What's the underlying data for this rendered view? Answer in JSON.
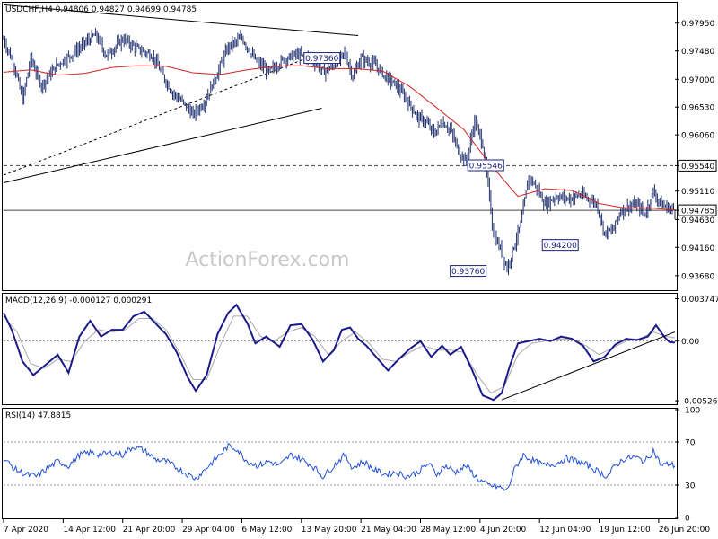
{
  "header": {
    "price_title": "USDCHF,H4  0.94806 0.94827 0.94699 0.94785",
    "macd_title": "MACD(12,26,9) -0.000127 0.000291",
    "rsi_title": "RSI(14) 47.8815"
  },
  "watermark": "ActionForex.com",
  "colors": {
    "price_bar": "#1f2f6e",
    "moving_average": "#d32020",
    "macd_line": "#1a1a8a",
    "macd_signal": "#a8a8a8",
    "rsi_line": "#1f4fd8",
    "trendline": "#000000",
    "hline": "#444444",
    "label_border": "#1a237e",
    "label_text": "#1a237e"
  },
  "chart_data": [
    {
      "type": "candlestick",
      "title": "USDCHF,H4  0.94806 0.94827 0.94699 0.94785",
      "ylim": [
        0.9345,
        0.9828
      ],
      "y_ticks": [
        "0.97950",
        "0.97480",
        "0.97000",
        "0.96530",
        "0.96060",
        "0.95540",
        "0.95110",
        "0.94785",
        "0.94630",
        "0.94160",
        "0.93680"
      ],
      "y_tick_values": [
        0.9795,
        0.9748,
        0.97,
        0.9653,
        0.9606,
        0.9554,
        0.9511,
        0.94785,
        0.9463,
        0.9416,
        0.9368
      ],
      "highlighted_ticks": [
        "0.95540",
        "0.94785"
      ],
      "x_labels": [
        "7 Apr 2020",
        "14 Apr 12:00",
        "21 Apr 20:00",
        "29 Apr 04:00",
        "6 May 12:00",
        "13 May 20:00",
        "21 May 04:00",
        "28 May 12:00",
        "4 Jun 20:00",
        "12 Jun 04:00",
        "19 Jun 12:00",
        "26 Jun 20:00"
      ],
      "x_label_index": [
        0,
        44,
        88,
        132,
        176,
        220,
        264,
        308,
        352,
        396,
        440,
        484
      ],
      "bar_count": 497,
      "close_anchors": [
        [
          0,
          0.9768
        ],
        [
          8,
          0.9722
        ],
        [
          14,
          0.9665
        ],
        [
          20,
          0.9735
        ],
        [
          28,
          0.969
        ],
        [
          40,
          0.9725
        ],
        [
          52,
          0.9745
        ],
        [
          62,
          0.9765
        ],
        [
          68,
          0.9775
        ],
        [
          76,
          0.974
        ],
        [
          88,
          0.9768
        ],
        [
          100,
          0.975
        ],
        [
          110,
          0.974
        ],
        [
          118,
          0.9705
        ],
        [
          124,
          0.968
        ],
        [
          132,
          0.9662
        ],
        [
          140,
          0.964
        ],
        [
          148,
          0.966
        ],
        [
          156,
          0.97
        ],
        [
          166,
          0.9755
        ],
        [
          176,
          0.977
        ],
        [
          186,
          0.9732
        ],
        [
          196,
          0.9712
        ],
        [
          206,
          0.9732
        ],
        [
          216,
          0.9742
        ],
        [
          228,
          0.9735
        ],
        [
          236,
          0.9712
        ],
        [
          244,
          0.9723
        ],
        [
          252,
          0.9745
        ],
        [
          258,
          0.9705
        ],
        [
          264,
          0.9735
        ],
        [
          274,
          0.9725
        ],
        [
          282,
          0.9705
        ],
        [
          290,
          0.969
        ],
        [
          298,
          0.9665
        ],
        [
          306,
          0.9635
        ],
        [
          312,
          0.9628
        ],
        [
          318,
          0.9608
        ],
        [
          324,
          0.9628
        ],
        [
          330,
          0.9615
        ],
        [
          336,
          0.958
        ],
        [
          342,
          0.956
        ],
        [
          348,
          0.963
        ],
        [
          354,
          0.959
        ],
        [
          358,
          0.952
        ],
        [
          362,
          0.9438
        ],
        [
          368,
          0.9408
        ],
        [
          372,
          0.938
        ],
        [
          376,
          0.941
        ],
        [
          382,
          0.9455
        ],
        [
          388,
          0.9535
        ],
        [
          394,
          0.9516
        ],
        [
          400,
          0.9488
        ],
        [
          408,
          0.9502
        ],
        [
          418,
          0.9498
        ],
        [
          426,
          0.9505
        ],
        [
          432,
          0.9498
        ],
        [
          438,
          0.949
        ],
        [
          444,
          0.944
        ],
        [
          450,
          0.9444
        ],
        [
          456,
          0.9478
        ],
        [
          462,
          0.9485
        ],
        [
          468,
          0.9488
        ],
        [
          474,
          0.9472
        ],
        [
          480,
          0.951
        ],
        [
          486,
          0.9488
        ],
        [
          492,
          0.9482
        ],
        [
          496,
          0.94785
        ]
      ],
      "moving_average_anchors": [
        [
          0,
          0.9712
        ],
        [
          20,
          0.9716
        ],
        [
          40,
          0.9707
        ],
        [
          60,
          0.971
        ],
        [
          80,
          0.972
        ],
        [
          100,
          0.9723
        ],
        [
          120,
          0.9722
        ],
        [
          140,
          0.9711
        ],
        [
          160,
          0.9708
        ],
        [
          180,
          0.9716
        ],
        [
          200,
          0.9722
        ],
        [
          220,
          0.9723
        ],
        [
          240,
          0.9718
        ],
        [
          260,
          0.9718
        ],
        [
          280,
          0.9714
        ],
        [
          300,
          0.9688
        ],
        [
          320,
          0.9652
        ],
        [
          340,
          0.9615
        ],
        [
          360,
          0.9555
        ],
        [
          380,
          0.9502
        ],
        [
          400,
          0.9515
        ],
        [
          420,
          0.9512
        ],
        [
          440,
          0.949
        ],
        [
          460,
          0.9482
        ],
        [
          480,
          0.9482
        ],
        [
          496,
          0.9479
        ]
      ],
      "horizontal_lines": [
        0.9554,
        0.94785
      ],
      "trendlines": [
        {
          "from": [
            0,
            0.9826
          ],
          "to": [
            145,
            0.979
          ],
          "extend_to": 262,
          "extend_value": 0.9774
        },
        {
          "from": [
            0,
            0.9525
          ],
          "to": [
            230,
            0.9648
          ],
          "extend_to": 235,
          "extend_value": 0.9651
        },
        {
          "from": [
            0,
            0.9538
          ],
          "to": [
            230,
            0.9741
          ],
          "extend_to": 230,
          "extend_value": 0.9741,
          "dashed": true
        }
      ],
      "annotations": [
        {
          "text": "0.97360",
          "x_index": 222,
          "value": 0.9736
        },
        {
          "text": "0.95546",
          "x_index": 343,
          "value": 0.95546
        },
        {
          "text": "0.93760",
          "x_index": 330,
          "value": 0.9376
        },
        {
          "text": "0.94200",
          "x_index": 398,
          "value": 0.942
        }
      ]
    },
    {
      "type": "line",
      "title": "MACD(12,26,9) -0.000127 0.000291",
      "ylim": [
        -0.0055,
        0.0041
      ],
      "y_ticks": [
        "0.003747",
        "0.00",
        "-0.005269"
      ],
      "y_tick_values": [
        0.003747,
        0.0,
        -0.005269
      ],
      "zero_line_dashed": true,
      "macd_anchors": [
        [
          0,
          0.0025
        ],
        [
          6,
          0.001
        ],
        [
          14,
          -0.0018
        ],
        [
          22,
          -0.003
        ],
        [
          30,
          -0.0022
        ],
        [
          40,
          -0.0012
        ],
        [
          48,
          -0.0028
        ],
        [
          56,
          0.0004
        ],
        [
          64,
          0.0018
        ],
        [
          72,
          0.0004
        ],
        [
          80,
          0.001
        ],
        [
          88,
          0.001
        ],
        [
          96,
          0.0022
        ],
        [
          104,
          0.0026
        ],
        [
          112,
          0.0016
        ],
        [
          120,
          0.0006
        ],
        [
          128,
          -0.001
        ],
        [
          136,
          -0.0032
        ],
        [
          142,
          -0.0044
        ],
        [
          150,
          -0.003
        ],
        [
          158,
          0.0006
        ],
        [
          166,
          0.0025
        ],
        [
          172,
          0.0032
        ],
        [
          180,
          0.0016
        ],
        [
          186,
          -0.0002
        ],
        [
          194,
          0.0004
        ],
        [
          204,
          -0.0005
        ],
        [
          212,
          0.0014
        ],
        [
          220,
          0.0015
        ],
        [
          228,
          0.0002
        ],
        [
          236,
          -0.0018
        ],
        [
          244,
          -0.0008
        ],
        [
          250,
          0.001
        ],
        [
          256,
          0.0012
        ],
        [
          262,
          0.0002
        ],
        [
          268,
          -0.0004
        ],
        [
          276,
          -0.0015
        ],
        [
          284,
          -0.0026
        ],
        [
          292,
          -0.0016
        ],
        [
          300,
          -0.0007
        ],
        [
          308,
          0.0
        ],
        [
          316,
          -0.0014
        ],
        [
          324,
          -0.0004
        ],
        [
          330,
          -0.0012
        ],
        [
          338,
          -0.0005
        ],
        [
          346,
          -0.0025
        ],
        [
          354,
          -0.0048
        ],
        [
          362,
          -0.0052
        ],
        [
          368,
          -0.0046
        ],
        [
          374,
          -0.0022
        ],
        [
          380,
          -0.0002
        ],
        [
          388,
          0.0
        ],
        [
          396,
          0.0002
        ],
        [
          404,
          0.0
        ],
        [
          412,
          0.0004
        ],
        [
          420,
          0.0002
        ],
        [
          428,
          -0.0004
        ],
        [
          436,
          -0.0018
        ],
        [
          444,
          -0.0014
        ],
        [
          452,
          -0.0003
        ],
        [
          460,
          0.0002
        ],
        [
          468,
          0.0001
        ],
        [
          476,
          0.0004
        ],
        [
          482,
          0.0014
        ],
        [
          488,
          0.0004
        ],
        [
          492,
          -0.0001
        ],
        [
          496,
          -0.000127
        ]
      ],
      "signal_anchors": [
        [
          0,
          0.0022
        ],
        [
          10,
          0.0008
        ],
        [
          20,
          -0.002
        ],
        [
          30,
          -0.0024
        ],
        [
          40,
          -0.0016
        ],
        [
          50,
          -0.0018
        ],
        [
          60,
          0.0
        ],
        [
          70,
          0.001
        ],
        [
          80,
          0.0008
        ],
        [
          90,
          0.001
        ],
        [
          100,
          0.002
        ],
        [
          110,
          0.002
        ],
        [
          120,
          0.001
        ],
        [
          130,
          -0.001
        ],
        [
          140,
          -0.0034
        ],
        [
          150,
          -0.0034
        ],
        [
          160,
          -0.0004
        ],
        [
          170,
          0.0022
        ],
        [
          180,
          0.0022
        ],
        [
          190,
          0.0004
        ],
        [
          200,
          0.0
        ],
        [
          210,
          0.0008
        ],
        [
          220,
          0.0012
        ],
        [
          230,
          0.0004
        ],
        [
          240,
          -0.0012
        ],
        [
          250,
          0.0
        ],
        [
          260,
          0.0008
        ],
        [
          270,
          -0.0002
        ],
        [
          280,
          -0.0016
        ],
        [
          290,
          -0.0018
        ],
        [
          300,
          -0.001
        ],
        [
          310,
          -0.0004
        ],
        [
          320,
          -0.0008
        ],
        [
          330,
          -0.0008
        ],
        [
          340,
          -0.001
        ],
        [
          350,
          -0.003
        ],
        [
          360,
          -0.0046
        ],
        [
          370,
          -0.004
        ],
        [
          380,
          -0.0012
        ],
        [
          390,
          -0.0002
        ],
        [
          400,
          0.0
        ],
        [
          410,
          0.0002
        ],
        [
          420,
          0.0002
        ],
        [
          430,
          -0.0004
        ],
        [
          440,
          -0.0012
        ],
        [
          450,
          -0.0006
        ],
        [
          460,
          0.0
        ],
        [
          470,
          0.0002
        ],
        [
          480,
          0.0008
        ],
        [
          490,
          0.0004
        ],
        [
          496,
          0.000291
        ]
      ],
      "trendline": {
        "from": [
          368,
          -0.0052
        ],
        "to": [
          496,
          0.0008
        ]
      }
    },
    {
      "type": "line",
      "title": "RSI(14) 47.8815",
      "ylim": [
        0,
        100
      ],
      "y_ticks": [
        "100",
        "70",
        "30",
        "0"
      ],
      "y_tick_values": [
        100,
        70,
        30,
        0
      ],
      "dashed_levels": [
        70,
        30
      ],
      "rsi_anchors": [
        [
          0,
          55
        ],
        [
          8,
          45
        ],
        [
          16,
          40
        ],
        [
          24,
          38
        ],
        [
          32,
          45
        ],
        [
          40,
          52
        ],
        [
          48,
          48
        ],
        [
          56,
          58
        ],
        [
          64,
          60
        ],
        [
          72,
          58
        ],
        [
          80,
          60
        ],
        [
          88,
          58
        ],
        [
          96,
          66
        ],
        [
          104,
          62
        ],
        [
          112,
          54
        ],
        [
          120,
          52
        ],
        [
          128,
          46
        ],
        [
          136,
          40
        ],
        [
          142,
          36
        ],
        [
          150,
          46
        ],
        [
          158,
          56
        ],
        [
          166,
          66
        ],
        [
          172,
          64
        ],
        [
          180,
          52
        ],
        [
          188,
          48
        ],
        [
          196,
          52
        ],
        [
          204,
          48
        ],
        [
          212,
          58
        ],
        [
          220,
          54
        ],
        [
          228,
          48
        ],
        [
          236,
          38
        ],
        [
          244,
          48
        ],
        [
          252,
          58
        ],
        [
          258,
          46
        ],
        [
          266,
          52
        ],
        [
          274,
          44
        ],
        [
          282,
          40
        ],
        [
          290,
          42
        ],
        [
          298,
          38
        ],
        [
          306,
          42
        ],
        [
          314,
          50
        ],
        [
          320,
          40
        ],
        [
          326,
          48
        ],
        [
          334,
          42
        ],
        [
          342,
          48
        ],
        [
          350,
          36
        ],
        [
          358,
          30
        ],
        [
          366,
          28
        ],
        [
          372,
          25
        ],
        [
          378,
          46
        ],
        [
          384,
          58
        ],
        [
          392,
          52
        ],
        [
          400,
          48
        ],
        [
          408,
          50
        ],
        [
          416,
          55
        ],
        [
          424,
          52
        ],
        [
          432,
          48
        ],
        [
          440,
          42
        ],
        [
          446,
          38
        ],
        [
          452,
          48
        ],
        [
          458,
          54
        ],
        [
          466,
          56
        ],
        [
          474,
          52
        ],
        [
          480,
          62
        ],
        [
          486,
          48
        ],
        [
          492,
          50
        ],
        [
          496,
          47.88
        ]
      ]
    }
  ]
}
